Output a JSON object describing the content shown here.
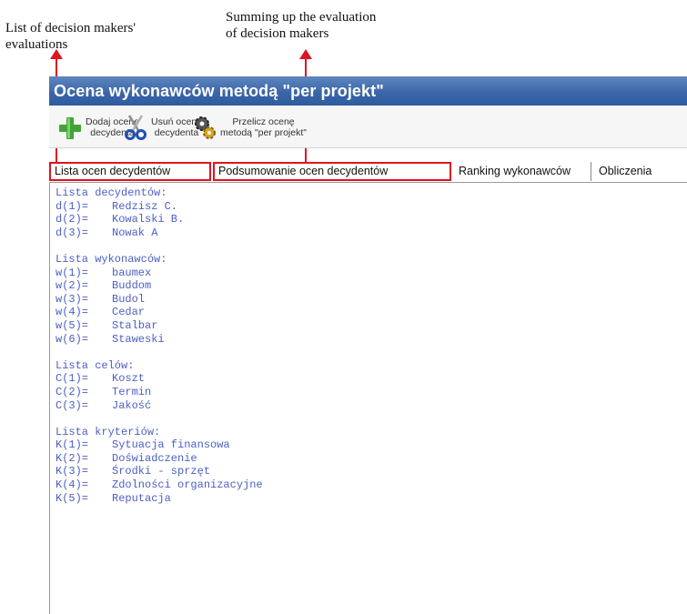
{
  "annotations": {
    "left_line1": "List of decision makers'",
    "left_line2": "evaluations",
    "right_line1": "Summing up  the evaluation",
    "right_line2": "of decision  makers",
    "arrow_color": "#e0141e"
  },
  "window": {
    "title": "Ocena wykonawców metodą \"per projekt\"",
    "title_bar_color": "#3b66a9"
  },
  "toolbar": {
    "add": {
      "line1": "Dodaj ocenę",
      "line2": "decydenta",
      "icon": "plus-icon"
    },
    "remove": {
      "line1": "Usuń ocenę",
      "line2": "decydenta",
      "icon": "scissors-icon"
    },
    "recalc": {
      "line1": "Przelicz ocenę",
      "line2": "metodą \"per projekt\"",
      "icon": "gears-icon"
    }
  },
  "tabs": [
    {
      "label": "Lista ocen decydentów",
      "highlighted": true
    },
    {
      "label": "Podsumowanie ocen decydentów",
      "highlighted": true,
      "selected": true
    },
    {
      "label": "Ranking wykonawców",
      "highlighted": false
    },
    {
      "label": "Obliczenia",
      "highlighted": false
    }
  ],
  "content": {
    "text_color": "#4c5fc4",
    "sections": [
      {
        "title": "Lista decydentów:",
        "rows": [
          {
            "k": "d(1)=",
            "v": "Redzisz C."
          },
          {
            "k": "d(2)=",
            "v": "Kowalski B."
          },
          {
            "k": "d(3)=",
            "v": "Nowak A"
          }
        ]
      },
      {
        "title": "Lista wykonawców:",
        "rows": [
          {
            "k": "w(1)=",
            "v": "baumex"
          },
          {
            "k": "w(2)=",
            "v": "Buddom"
          },
          {
            "k": "w(3)=",
            "v": "Budol"
          },
          {
            "k": "w(4)=",
            "v": "Cedar"
          },
          {
            "k": "w(5)=",
            "v": "Stalbar"
          },
          {
            "k": "w(6)=",
            "v": "Staweski"
          }
        ]
      },
      {
        "title": "Lista celów:",
        "rows": [
          {
            "k": "C(1)=",
            "v": "Koszt"
          },
          {
            "k": "C(2)=",
            "v": "Termin"
          },
          {
            "k": "C(3)=",
            "v": "Jakość"
          }
        ]
      },
      {
        "title": "Lista kryteriów:",
        "rows": [
          {
            "k": "K(1)=",
            "v": "Sytuacja finansowa"
          },
          {
            "k": "K(2)=",
            "v": "Doświadczenie"
          },
          {
            "k": "K(3)=",
            "v": "Środki - sprzęt"
          },
          {
            "k": "K(4)=",
            "v": "Zdolności organizacyjne"
          },
          {
            "k": "K(5)=",
            "v": "Reputacja"
          }
        ]
      }
    ]
  }
}
